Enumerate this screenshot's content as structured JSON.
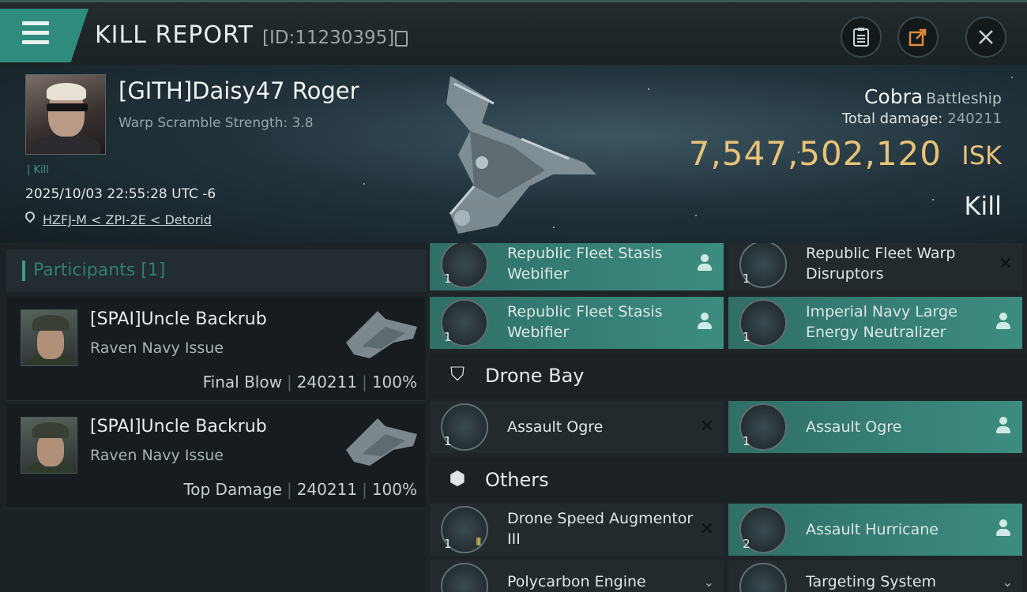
{
  "header": {
    "title": "KILL REPORT",
    "report_id": "[ID:11230395]",
    "buttons": {
      "copy": "clipboard-icon",
      "share": "share-icon",
      "close": "close-icon"
    }
  },
  "victim": {
    "name": "[GITH]Daisy47 Roger",
    "warp_scramble": "Warp Scramble Strength: 3.8",
    "kill_tag": "| Kill",
    "datetime": "2025/10/03 22:55:28 UTC -6",
    "location": "HZFJ-M < ZPI-2E < Detorid",
    "ship_name": "Cobra",
    "ship_class": "Battleship",
    "total_damage_label": "Total damage:",
    "total_damage_value": "240211",
    "isk_value": "7,547,502,120",
    "isk_unit": "ISK",
    "result": "Kill"
  },
  "participants": {
    "title": "Participants [1]",
    "items": [
      {
        "name": "[SPAI]Uncle Backrub",
        "ship": "Raven Navy Issue",
        "role": "Final Blow",
        "damage": "240211",
        "percent": "100%"
      },
      {
        "name": "[SPAI]Uncle Backrub",
        "ship": "Raven Navy Issue",
        "role": "Top Damage",
        "damage": "240211",
        "percent": "100%"
      }
    ]
  },
  "fitting": {
    "slots": [
      {
        "name": "Republic Fleet Stasis Webifier",
        "qty": "1",
        "status": "dropped"
      },
      {
        "name": "Republic Fleet Warp Disruptors",
        "qty": "1",
        "status": "destroyed"
      },
      {
        "name": "Republic Fleet Stasis Webifier",
        "qty": "1",
        "status": "dropped"
      },
      {
        "name": "Imperial Navy Large Energy Neutralizer",
        "qty": "1",
        "status": "dropped"
      }
    ],
    "drone_bay": {
      "title": "Drone Bay",
      "items": [
        {
          "name": "Assault Ogre",
          "qty": "1",
          "status": "destroyed"
        },
        {
          "name": "Assault Ogre",
          "qty": "1",
          "status": "dropped"
        }
      ]
    },
    "others": {
      "title": "Others",
      "items": [
        {
          "name": "Drone Speed Augmentor III",
          "qty": "1",
          "status": "destroyed"
        },
        {
          "name": "Assault Hurricane",
          "qty": "2",
          "status": "dropped"
        },
        {
          "name": "Polycarbon Engine",
          "qty": "",
          "status": "destroyed"
        },
        {
          "name": "Targeting System",
          "qty": "",
          "status": "destroyed"
        }
      ]
    }
  },
  "colors": {
    "accent": "#3a9a8a",
    "isk": "#e7c277",
    "dropped_bg": "#3c8c7f"
  }
}
